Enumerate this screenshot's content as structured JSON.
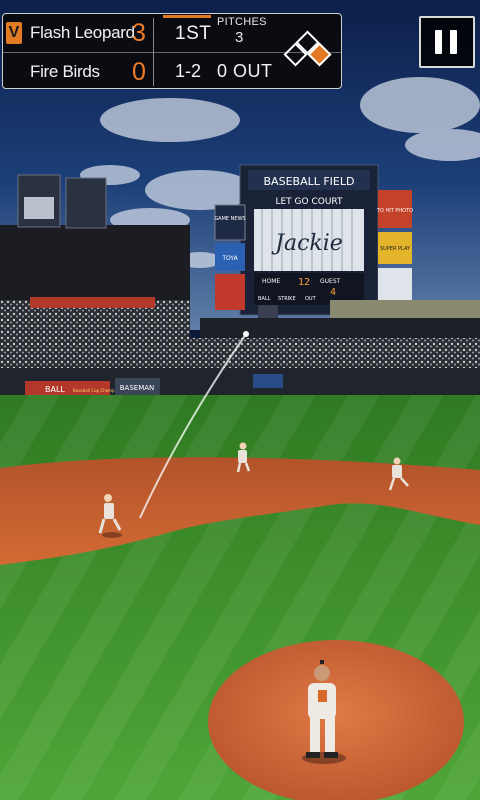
{
  "scoreboard": {
    "visitor_badge": "V",
    "away_team": {
      "name": "Flash Leopard",
      "runs": "3"
    },
    "home_team": {
      "name": "Fire Birds",
      "runs": "0"
    },
    "inning": "1ST",
    "pitches_label": "PITCHES",
    "pitches": "3",
    "count": "1-2",
    "outs": "0 OUT",
    "runners_on_base": {
      "first": true,
      "second": false,
      "third": false
    }
  },
  "stadium": {
    "main_board_title": "BASEBALL FIELD",
    "main_board_message": "LET GO COURT",
    "main_board_name": "Jackie",
    "board_home_label": "HOME",
    "board_guest_label": "GUEST",
    "board_home_value": "12",
    "board_guest_value": "4",
    "board_ball_label": "BALL",
    "board_strike_label": "STRIKE",
    "board_out_label": "OUT",
    "left_ad_1": "GAME NEWS",
    "left_ad_2": "TOYA",
    "right_ad_1": "TO HIT PHOTO",
    "right_ad_2": "SUPER PLAY",
    "outfield_sign": "BASEMAN",
    "wall_banner_1": "BALL",
    "wall_banner_2": "Baseball Cup Championship"
  },
  "colors": {
    "accent_orange": "#e27a24",
    "runs_orange": "#ef7c26",
    "field_green": "#3d8a2a",
    "infield_dirt": "#c9602f"
  },
  "controls": {
    "pause_icon": "pause-icon"
  }
}
